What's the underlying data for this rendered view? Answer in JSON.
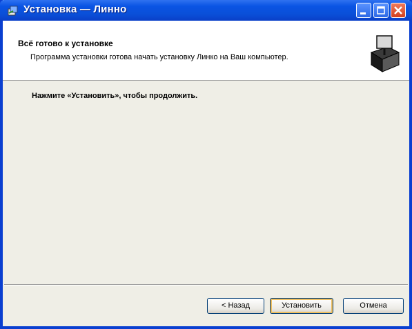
{
  "window": {
    "title": "Установка — Линно",
    "controls": [
      "minimize",
      "maximize",
      "close"
    ]
  },
  "header": {
    "title": "Всё готово к установке",
    "subtitle": "Программа установки готова начать установку Линко на Ваш компьютер.",
    "icon": "installer-box-icon"
  },
  "body": {
    "instruction": "Нажмите «Установить», чтобы продолжить."
  },
  "buttons": {
    "back": "< Назад",
    "install": "Установить",
    "cancel": "Отмена"
  },
  "colors": {
    "titlebar": "#0a54e4",
    "close": "#d2401e",
    "dialog_bg": "#efeee6",
    "header_bg": "#ffffff"
  }
}
